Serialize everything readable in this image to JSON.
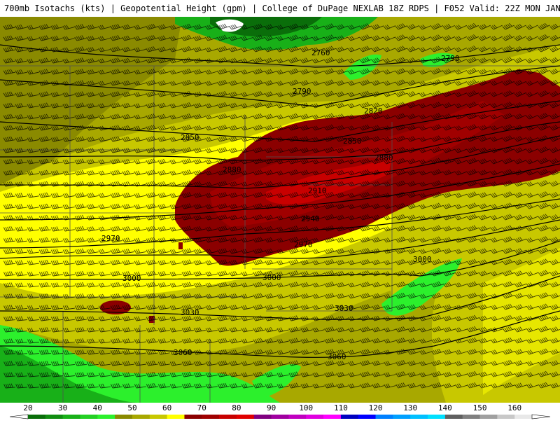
{
  "header": {
    "text": "700mb Isotachs (kts) | Geopotential Height (gpm) | College of DuPage NEXLAB   18Z RDPS | F052 Valid: 22Z MON JAN 19 2026"
  },
  "legend": {
    "bins": [
      {
        "value": 20,
        "color": "#0a6e0a"
      },
      {
        "value": 25,
        "color": "#118d11"
      },
      {
        "value": 30,
        "color": "#18b018"
      },
      {
        "value": 35,
        "color": "#24d024"
      },
      {
        "value": 40,
        "color": "#2cf02c"
      },
      {
        "value": 45,
        "color": "#8a8a00"
      },
      {
        "value": 50,
        "color": "#a8a800"
      },
      {
        "value": 55,
        "color": "#c8c800"
      },
      {
        "value": 60,
        "color": "#ffff00"
      },
      {
        "value": 65,
        "color": "#8b0000"
      },
      {
        "value": 70,
        "color": "#a00000"
      },
      {
        "value": 75,
        "color": "#c80000"
      },
      {
        "value": 80,
        "color": "#e00000"
      },
      {
        "value": 85,
        "color": "#800080"
      },
      {
        "value": 90,
        "color": "#a000a0"
      },
      {
        "value": 95,
        "color": "#c000c0"
      },
      {
        "value": 100,
        "color": "#e000e0"
      },
      {
        "value": 105,
        "color": "#ff00ff"
      },
      {
        "value": 110,
        "color": "#0000c0"
      },
      {
        "value": 115,
        "color": "#0000ff"
      },
      {
        "value": 120,
        "color": "#0080ff"
      },
      {
        "value": 125,
        "color": "#00a0ff"
      },
      {
        "value": 130,
        "color": "#00c0ff"
      },
      {
        "value": 135,
        "color": "#00e0ff"
      },
      {
        "value": 140,
        "color": "#606060"
      },
      {
        "value": 145,
        "color": "#808080"
      },
      {
        "value": 150,
        "color": "#a0a0a0"
      },
      {
        "value": 155,
        "color": "#c8c8c8"
      },
      {
        "value": 160,
        "color": "#e8e8e8"
      }
    ],
    "labels": [
      "20",
      "30",
      "40",
      "50",
      "60",
      "70",
      "80",
      "90",
      "100",
      "110",
      "120",
      "130",
      "140",
      "150",
      "160"
    ]
  },
  "contour_labels": [
    "2760",
    "2790",
    "2790",
    "2820",
    "2850",
    "2850",
    "2880",
    "2880",
    "2910",
    "2940",
    "2970",
    "2970",
    "3000",
    "3000",
    "3000",
    "3030",
    "3030",
    "3060",
    "3060"
  ],
  "colors": {
    "olive": "#8a8a00",
    "olive_light": "#a8a800",
    "olive_yellow": "#c8c800",
    "yellow": "#ffff00",
    "dark_green": "#0a6e0a",
    "mid_green": "#18b018",
    "bright_green": "#2cf02c",
    "darkred": "#8b0000",
    "red": "#a00000",
    "brightred": "#c80000",
    "contour": "#000000",
    "borders": "#505050"
  }
}
